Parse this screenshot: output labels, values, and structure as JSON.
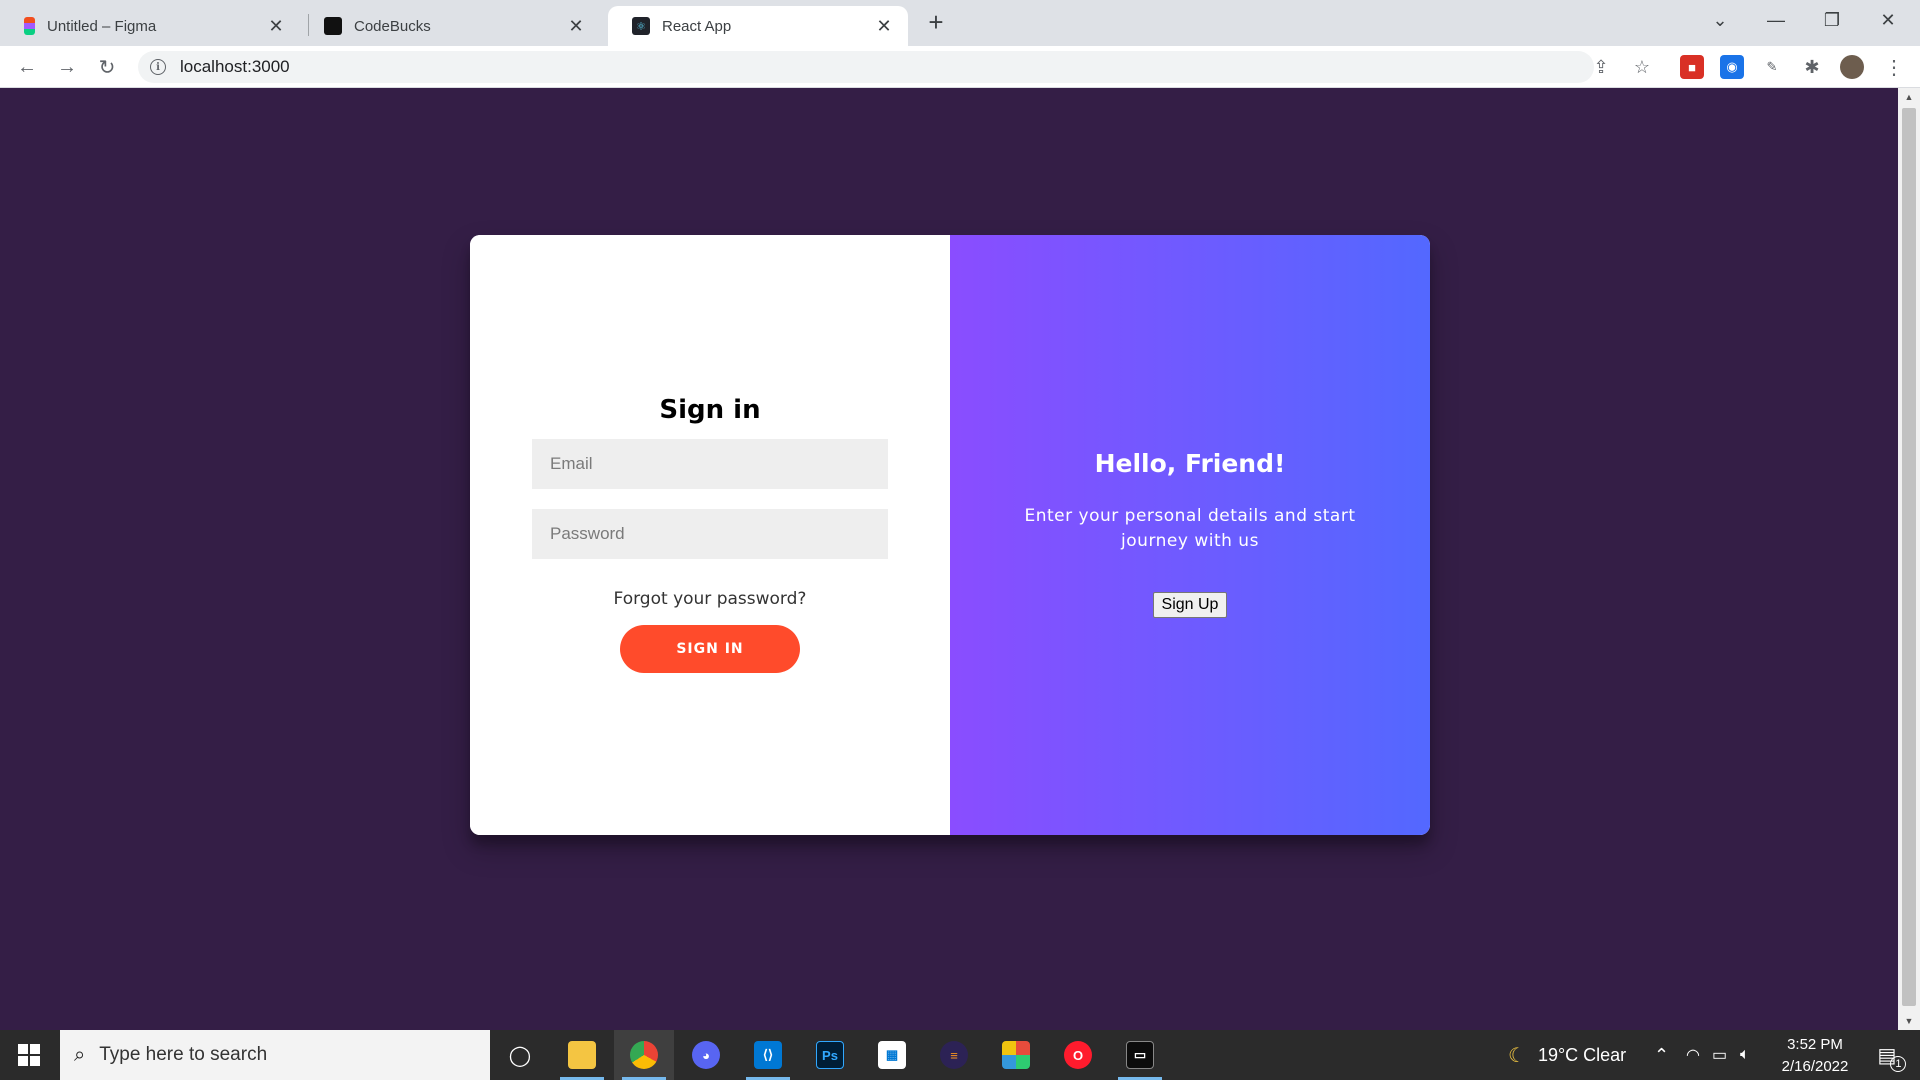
{
  "browser": {
    "tabs": [
      {
        "title": "Untitled – Figma",
        "active": false
      },
      {
        "title": "CodeBucks",
        "active": false
      },
      {
        "title": "React App",
        "active": true
      }
    ],
    "url": "localhost:3000"
  },
  "signin": {
    "heading": "Sign in",
    "email_placeholder": "Email",
    "password_placeholder": "Password",
    "forgot_link": "Forgot your password?",
    "button_label": "SIGN IN"
  },
  "overlay": {
    "heading": "Hello, Friend!",
    "text": "Enter your personal details and start journey with us",
    "button_label": "Sign Up"
  },
  "colors": {
    "page_bg": "#341e46",
    "accent_button": "#ff4b2b",
    "gradient_start": "#8a4dff",
    "gradient_end": "#5368ff"
  },
  "taskbar": {
    "search_placeholder": "Type here to search",
    "weather": "19°C  Clear",
    "time": "3:52 PM",
    "date": "2/16/2022",
    "notification_count": "1"
  }
}
